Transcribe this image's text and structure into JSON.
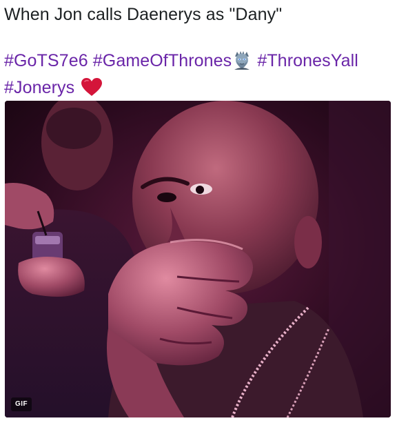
{
  "tweet": {
    "text_line_1": "When Jon calls Daenerys as \"Dany\"",
    "hashtags": [
      "#GoTS7e6",
      "#GameOfThrones",
      "#ThronesYall",
      "#Jonerys"
    ]
  },
  "emojis": {
    "night_king": "night-king-emoji",
    "heart": "red-heart-emoji"
  },
  "media": {
    "badge_label": "GIF"
  },
  "colors": {
    "hashtag": "#6a25a8",
    "text": "#1c2022",
    "heart": "#d4153a"
  }
}
